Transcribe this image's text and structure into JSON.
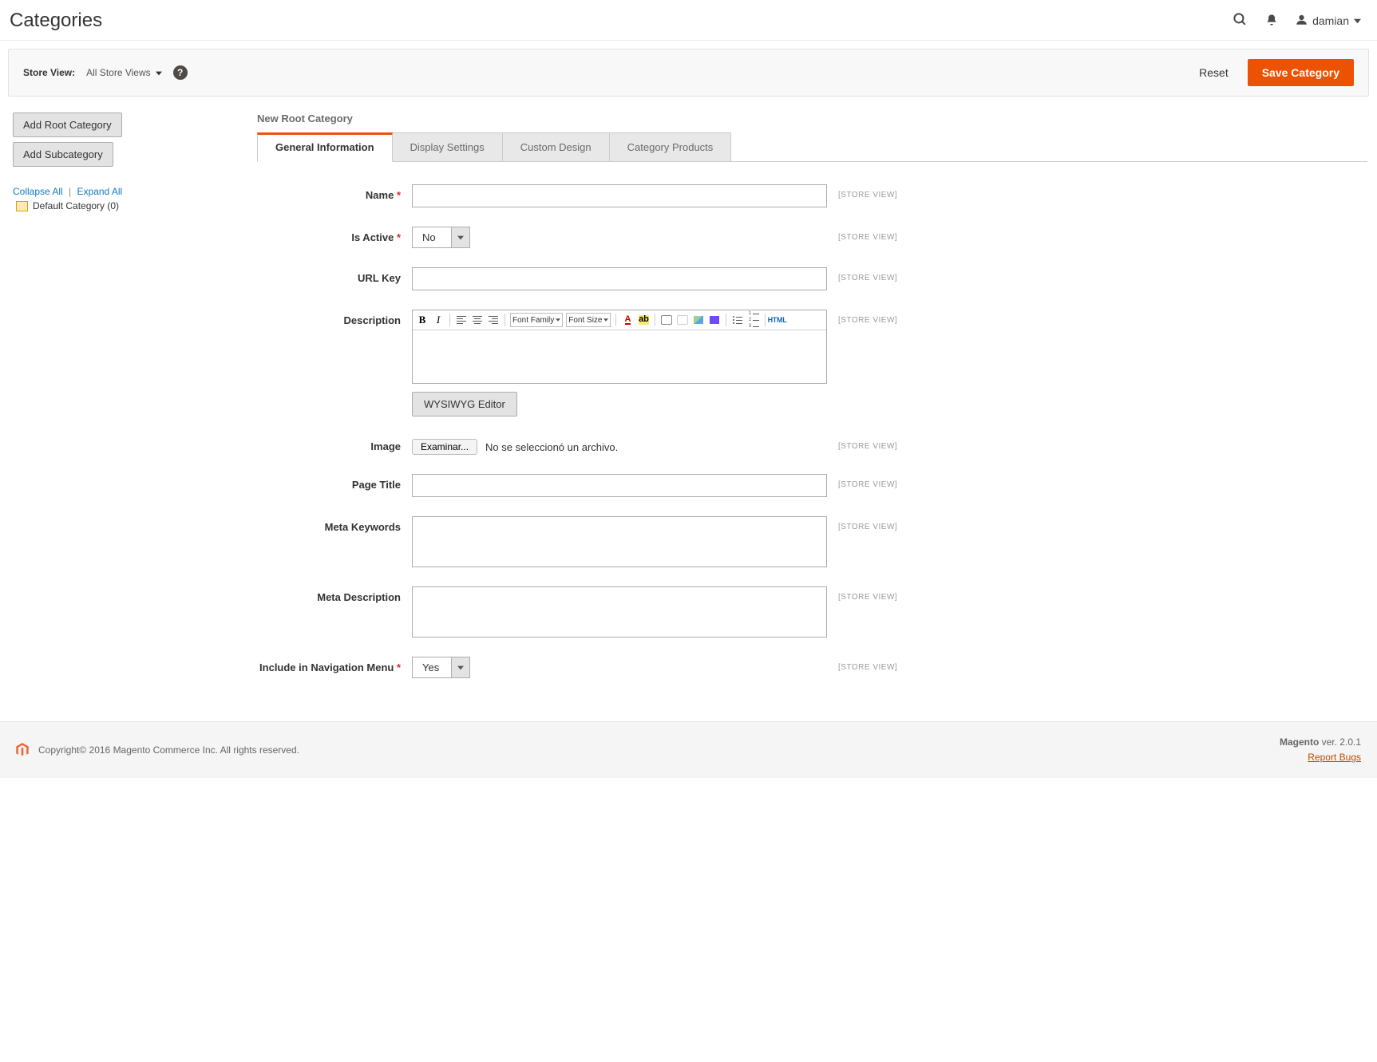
{
  "header": {
    "title": "Categories",
    "username": "damian"
  },
  "actions_bar": {
    "store_view_label": "Store View:",
    "store_view_value": "All Store Views",
    "reset": "Reset",
    "save": "Save Category"
  },
  "sidebar": {
    "add_root": "Add Root Category",
    "add_sub": "Add Subcategory",
    "collapse_all": "Collapse All",
    "expand_all": "Expand All",
    "tree_item": "Default Category (0)"
  },
  "main": {
    "panel_title": "New Root Category",
    "tabs": [
      "General Information",
      "Display Settings",
      "Custom Design",
      "Category Products"
    ],
    "scope_label": "[STORE VIEW]",
    "fields": {
      "name_label": "Name",
      "is_active_label": "Is Active",
      "is_active_value": "No",
      "url_key_label": "URL Key",
      "description_label": "Description",
      "wysiwyg_button": "WYSIWYG Editor",
      "image_label": "Image",
      "file_browse": "Examinar...",
      "file_status": "No se seleccionó un archivo.",
      "page_title_label": "Page Title",
      "meta_keywords_label": "Meta Keywords",
      "meta_description_label": "Meta Description",
      "include_nav_label": "Include in Navigation Menu",
      "include_nav_value": "Yes"
    },
    "rte": {
      "font_family": "Font Family",
      "font_size": "Font Size",
      "html": "HTML"
    }
  },
  "footer": {
    "copyright": "Copyright© 2016 Magento Commerce Inc. All rights reserved.",
    "product": "Magento",
    "version": " ver. 2.0.1",
    "report_bugs": "Report Bugs"
  }
}
